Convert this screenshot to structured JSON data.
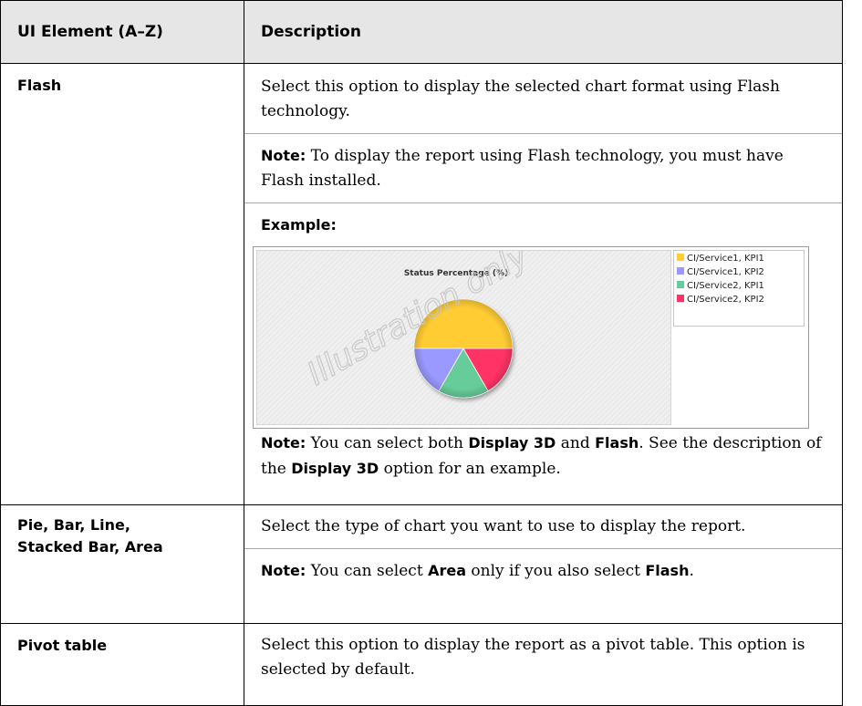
{
  "header": {
    "col1": "UI Element (A–Z)",
    "col2": "Description"
  },
  "rows": [
    {
      "element": "Flash",
      "p1": "Select this option to display the selected chart format using Flash technology.",
      "note1_label": "Note:",
      "note1_text": " To display the report using Flash technology, you must have Flash installed.",
      "example_label": "Example:",
      "note2": {
        "label": "Note:",
        "t1": " You can select both ",
        "b1": "Display 3D",
        "t2": " and ",
        "b2": "Flash",
        "t3": ". See the description of the ",
        "b3": "Display 3D",
        "t4": " option for an example."
      }
    },
    {
      "element_line1": "Pie, Bar, Line,",
      "element_line2": "Stacked Bar, Area",
      "p1": "Select the type of chart you want to use to display the report.",
      "note": {
        "label": "Note:",
        "t1": " You can select ",
        "b1": "Area",
        "t2": " only if you also select ",
        "b2": "Flash",
        "t3": "."
      }
    },
    {
      "element": "Pivot table",
      "p1": "Select this option to display the report as a pivot table. This option is selected by default."
    }
  ],
  "watermark": "Illustration only",
  "chart_data": {
    "type": "pie",
    "title": "Status Percentage (%)",
    "categories": [
      "CI/Service1, KPI1",
      "CI/Service1, KPI2",
      "CI/Service2, KPI1",
      "CI/Service2, KPI2"
    ],
    "values": [
      50,
      16.7,
      16.7,
      16.6
    ],
    "colors": [
      "#ffcc33",
      "#9999ff",
      "#66cc99",
      "#ff3366"
    ],
    "legend_position": "right"
  }
}
